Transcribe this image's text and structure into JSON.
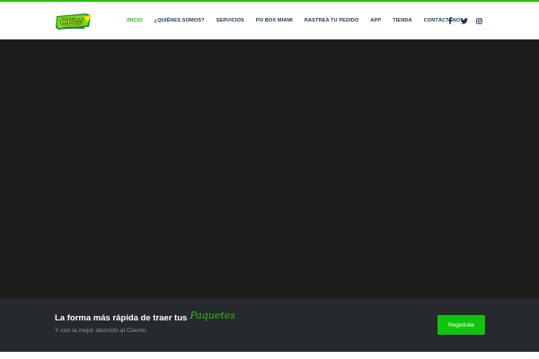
{
  "colors": {
    "accent": "#2dbb12",
    "nav_text": "#1e3350",
    "hero_bg": "#1d1d1e",
    "band_bg": "#26292e",
    "button_bg": "#11c40f"
  },
  "header": {
    "logo_icon": "brand-logo",
    "nav": [
      {
        "label": "INICIO",
        "active": true
      },
      {
        "label": "¿QUIÉNES SOMOS?"
      },
      {
        "label": "SERVICIOS"
      },
      {
        "label": "PO BOX MIAMI"
      },
      {
        "label": "RASTREA TU PEDIDO"
      },
      {
        "label": "APP"
      },
      {
        "label": "TIENDA"
      },
      {
        "label": "CONTÁCTENOS"
      }
    ],
    "social_icons": [
      "facebook-icon",
      "twitter-icon",
      "instagram-icon"
    ]
  },
  "cta": {
    "title": "La forma más rápida de traer tus",
    "title_accent": "Paquetes",
    "subtitle": "Y con la mejor atención al Cliente.",
    "button_label": "Registrate"
  }
}
